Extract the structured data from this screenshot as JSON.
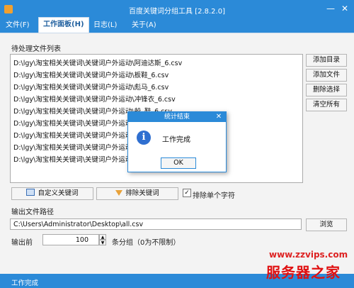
{
  "window": {
    "title": "百度关键词分组工具 [2.8.2.0]",
    "minimize_glyph": "—",
    "close_glyph": "✕"
  },
  "menu": {
    "items": [
      {
        "label": "文件(F)"
      },
      {
        "label": "工作面板(H)"
      },
      {
        "label": "日志(L)"
      },
      {
        "label": "关于(A)"
      }
    ],
    "active_index": 1
  },
  "pending_files": {
    "label": "待处理文件列表",
    "items": [
      "D:\\lgy\\淘宝相关关键词\\关键词户外运动\\阿迪达斯_6.csv",
      "D:\\lgy\\淘宝相关关键词\\关键词户外运动\\板鞋_6.csv",
      "D:\\lgy\\淘宝相关关键词\\关键词户外运动\\彪马_6.csv",
      "D:\\lgy\\淘宝相关关键词\\关键词户外运动\\冲锋衣_6.csv",
      "D:\\lgy\\淘宝相关关键词\\关键词户外运动\\船_鞋_6.csv",
      "D:\\lgy\\淘宝相关关键词\\关键词户外运动\\",
      "D:\\lgy\\淘宝相关关键词\\关键词户外运动\\",
      "D:\\lgy\\淘宝相关关键词\\关键词户外运动\\",
      "D:\\lgy\\淘宝相关关键词\\关键词户外运动\\"
    ]
  },
  "side_buttons": {
    "add_dir": "添加目录",
    "add_file": "添加文件",
    "delete_selected": "删除选择",
    "clear_all": "清空所有"
  },
  "keyword_buttons": {
    "custom": "自定义关键词",
    "exclude": "排除关键词",
    "exclude_single_char": "排除单个字符",
    "exclude_single_char_checked": true
  },
  "output": {
    "label": "输出文件路径",
    "path": "C:\\Users\\Administrator\\Desktop\\all.csv",
    "browse": "浏览",
    "count_label": "输出前",
    "count_value": "100",
    "count_suffix": "条分组（0为不限制）"
  },
  "status": {
    "text": "工作完成"
  },
  "dialog": {
    "title": "统计结束",
    "message": "工作完成",
    "ok": "OK",
    "close_glyph": "✕"
  },
  "watermark": {
    "url": "www.zzvips.com",
    "brand": "服务器之家"
  }
}
